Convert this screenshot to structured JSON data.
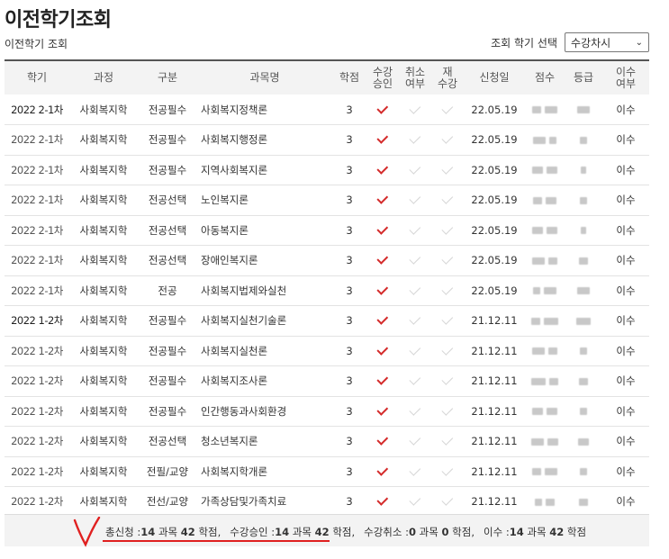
{
  "title": "이전학기조회",
  "breadcrumb": "이전학기 조회",
  "term_select": {
    "label": "조회 학기 선택",
    "value": "수강차시"
  },
  "headers": {
    "term": "학기",
    "course": "과정",
    "category": "구분",
    "subject": "과목명",
    "credits": "학점",
    "approved": [
      "수강",
      "승인"
    ],
    "cancelled": [
      "취소",
      "여부"
    ],
    "retake": [
      "재",
      "수강"
    ],
    "date": "신청일",
    "score": "점수",
    "grade": "등급",
    "completed": [
      "이수",
      "여부"
    ]
  },
  "rows": [
    {
      "term": "2022 2-1차",
      "course": "사회복지학",
      "category": "전공필수",
      "subject": "사회복지정책론",
      "credits": "3",
      "date": "22.05.19",
      "completed": "이수"
    },
    {
      "term": "2022 2-1차",
      "course": "사회복지학",
      "category": "전공필수",
      "subject": "사회복지행정론",
      "credits": "3",
      "date": "22.05.19",
      "completed": "이수"
    },
    {
      "term": "2022 2-1차",
      "course": "사회복지학",
      "category": "전공필수",
      "subject": "지역사회복지론",
      "credits": "3",
      "date": "22.05.19",
      "completed": "이수"
    },
    {
      "term": "2022 2-1차",
      "course": "사회복지학",
      "category": "전공선택",
      "subject": "노인복지론",
      "credits": "3",
      "date": "22.05.19",
      "completed": "이수"
    },
    {
      "term": "2022 2-1차",
      "course": "사회복지학",
      "category": "전공선택",
      "subject": "아동복지론",
      "credits": "3",
      "date": "22.05.19",
      "completed": "이수"
    },
    {
      "term": "2022 2-1차",
      "course": "사회복지학",
      "category": "전공선택",
      "subject": "장애인복지론",
      "credits": "3",
      "date": "22.05.19",
      "completed": "이수"
    },
    {
      "term": "2022 2-1차",
      "course": "사회복지학",
      "category": "전공",
      "subject": "사회복지법제와실천",
      "credits": "3",
      "date": "22.05.19",
      "completed": "이수"
    },
    {
      "term": "2022 1-2차",
      "course": "사회복지학",
      "category": "전공필수",
      "subject": "사회복지실천기술론",
      "credits": "3",
      "date": "21.12.11",
      "completed": "이수"
    },
    {
      "term": "2022 1-2차",
      "course": "사회복지학",
      "category": "전공필수",
      "subject": "사회복지실천론",
      "credits": "3",
      "date": "21.12.11",
      "completed": "이수"
    },
    {
      "term": "2022 1-2차",
      "course": "사회복지학",
      "category": "전공필수",
      "subject": "사회복지조사론",
      "credits": "3",
      "date": "21.12.11",
      "completed": "이수"
    },
    {
      "term": "2022 1-2차",
      "course": "사회복지학",
      "category": "전공필수",
      "subject": "인간행동과사회환경",
      "credits": "3",
      "date": "21.12.11",
      "completed": "이수"
    },
    {
      "term": "2022 1-2차",
      "course": "사회복지학",
      "category": "전공선택",
      "subject": "청소년복지론",
      "credits": "3",
      "date": "21.12.11",
      "completed": "이수"
    },
    {
      "term": "2022 1-2차",
      "course": "사회복지학",
      "category": "전필/교양",
      "subject": "사회복지학개론",
      "credits": "3",
      "date": "21.12.11",
      "completed": "이수"
    },
    {
      "term": "2022 1-2차",
      "course": "사회복지학",
      "category": "전선/교양",
      "subject": "가족상담및가족치료",
      "credits": "3",
      "date": "21.12.11",
      "completed": "이수"
    }
  ],
  "summary": {
    "total": {
      "label": "총신청 :",
      "courses": "14",
      "credits": "42",
      "u1": "과목",
      "u2": "학점,"
    },
    "approved": {
      "label": "수강승인 :",
      "courses": "14",
      "credits": "42",
      "u1": "과목",
      "u2": "학점,"
    },
    "cancelled": {
      "label": "수강취소 :",
      "courses": "0",
      "credits": "0",
      "u1": "과목",
      "u2": "학점,"
    },
    "completed": {
      "label": "이수 :",
      "courses": "14",
      "credits": "42",
      "u1": "과목",
      "u2": "학점"
    }
  },
  "colors": {
    "check_on": "#d42b2b",
    "check_off": "#d6d6d6",
    "annotation": "#e02020",
    "header_bg": "#f3f3f3"
  }
}
